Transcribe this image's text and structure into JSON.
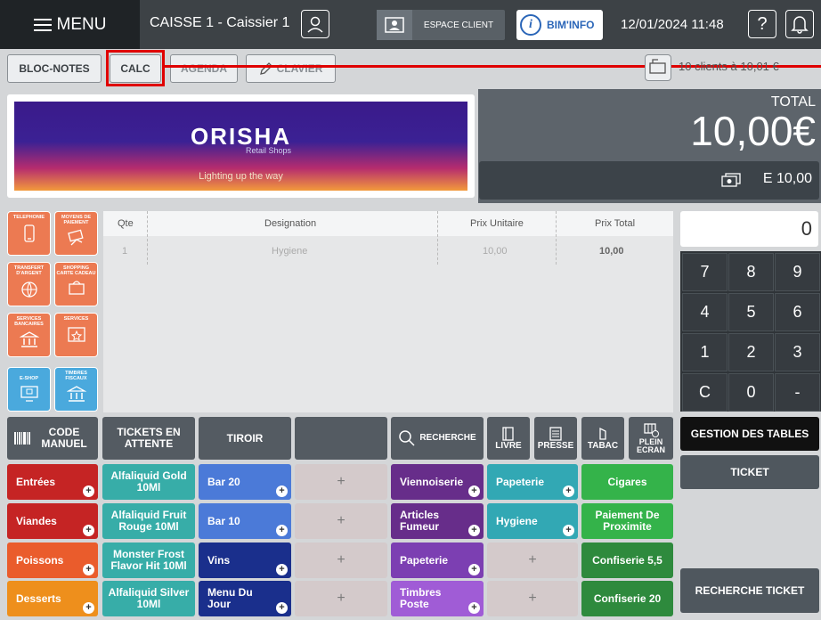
{
  "topbar": {
    "menu_label": "MENU",
    "register_label": "CAISSE 1 - Caissier 1",
    "espace_client_label": "ESPACE CLIENT",
    "bim_info_label": "BIM'INFO",
    "bim_info_icon_glyph": "i",
    "datetime": "12/01/2024 11:48",
    "help_glyph": "?"
  },
  "toolbar": {
    "bloc_notes": "BLOC-NOTES",
    "calc": "CALC",
    "agenda": "AGENDA",
    "clavier": "CLAVIER",
    "clients_text": "10 clients à 10,01 €"
  },
  "banner": {
    "logo": "ORISHA",
    "logo_sub": "Retail Shops",
    "tagline": "Lighting up the way"
  },
  "total": {
    "label": "TOTAL",
    "value": "10,00€",
    "subtotal": "E 10,00"
  },
  "side_tiles": [
    {
      "label": "TELEPHONIE",
      "color": "orange",
      "icon": "phone-icon"
    },
    {
      "label": "MOYENS DE PAIEMENT",
      "color": "orange",
      "icon": "payment-icon"
    },
    {
      "label": "TRANSFERT D'ARGENT",
      "color": "orange",
      "icon": "money-transfer-icon"
    },
    {
      "label": "SHOPPING CARTE CADEAU",
      "color": "orange",
      "icon": "gift-card-icon"
    },
    {
      "label": "SERVICES BANCAIRES",
      "color": "orange",
      "icon": "bank-icon"
    },
    {
      "label": "SERVICES",
      "color": "orange",
      "icon": "star-services-icon"
    },
    {
      "label": "E-SHOP",
      "color": "blue",
      "icon": "eshop-icon"
    },
    {
      "label": "TIMBRES FISCAUX",
      "color": "blue",
      "icon": "fiscal-stamp-icon"
    }
  ],
  "ticket": {
    "headers": [
      "Qte",
      "Designation",
      "Prix Unitaire",
      "Prix Total"
    ],
    "rows": [
      {
        "qty": "1",
        "designation": "Hygiene",
        "unit": "10,00",
        "total": "10,00"
      }
    ]
  },
  "keypad": {
    "display": "0",
    "keys": [
      "7",
      "8",
      "9",
      "4",
      "5",
      "6",
      "1",
      "2",
      "3",
      "C",
      "0",
      "-"
    ]
  },
  "actions": {
    "code_manuel": "CODE MANUEL",
    "tickets_attente": "TICKETS EN ATTENTE",
    "tiroir": "TIROIR",
    "recherche": "RECHERCHE",
    "livre": "LIVRE",
    "presse": "PRESSE",
    "tabac": "TABAC",
    "plein_ecran": "PLEIN ECRAN",
    "gestion_tables": "GESTION DES TABLES",
    "ticket": "TICKET",
    "recherche_ticket": "RECHERCHE TICKET"
  },
  "grid": {
    "col1": [
      "Entrées",
      "Viandes",
      "Poissons",
      "Desserts"
    ],
    "col2": [
      "Alfaliquid Gold 10Ml",
      "Alfaliquid Fruit Rouge 10Ml",
      "Monster Frost Flavor Hit 10Ml",
      "Alfaliquid Silver 10Ml"
    ],
    "col3": [
      "Bar 20",
      "Bar 10",
      "Vins",
      "Menu Du Jour"
    ],
    "col5": [
      "Viennoiserie",
      "Articles Fumeur",
      "Papeterie",
      "Timbres Poste"
    ],
    "col6": [
      "Papeterie",
      "Hygiene"
    ],
    "col7": [
      "Cigares",
      "Paiement De Proximite",
      "Confiserie 5,5",
      "Confiserie 20"
    ],
    "plus_glyph": "+"
  }
}
